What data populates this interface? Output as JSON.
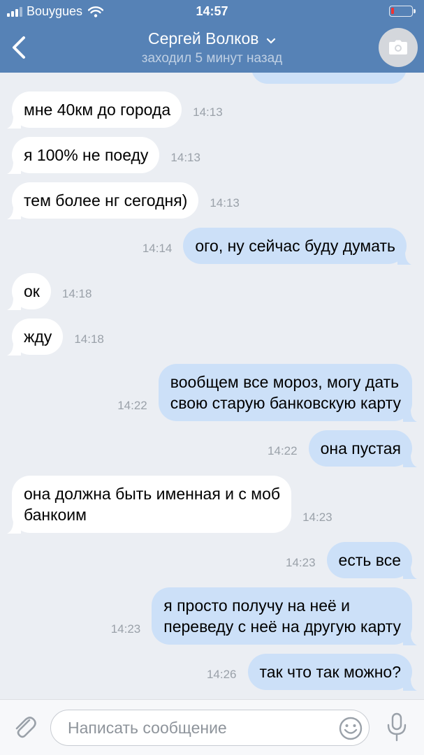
{
  "status_bar": {
    "carrier": "Bouygues",
    "time": "14:57",
    "battery_level": 0.15
  },
  "header": {
    "back_icon": "chevron-left-icon",
    "contact_name": "Сергей Волков",
    "status": "заходил 5 минут назад",
    "camera_icon": "camera-icon"
  },
  "messages": [
    {
      "dir": "in",
      "text": "мне 40км до города",
      "time": "14:13"
    },
    {
      "dir": "in",
      "text": "я 100% не поеду",
      "time": "14:13"
    },
    {
      "dir": "in",
      "text": "тем более нг сегодня)",
      "time": "14:13"
    },
    {
      "dir": "out",
      "text": "ого, ну сейчас буду думать",
      "time": "14:14"
    },
    {
      "dir": "in",
      "text": "ок",
      "time": "14:18"
    },
    {
      "dir": "in",
      "text": "жду",
      "time": "14:18"
    },
    {
      "dir": "out",
      "lines": [
        "вообщем все мороз, могу дать",
        "свою старую банковскую карту"
      ],
      "time": "14:22"
    },
    {
      "dir": "out",
      "text": "она пустая",
      "time": "14:22"
    },
    {
      "dir": "in",
      "lines": [
        "она должна быть именная и с моб",
        "банкоим"
      ],
      "time": "14:23"
    },
    {
      "dir": "out",
      "text": "есть все",
      "time": "14:23"
    },
    {
      "dir": "out",
      "lines": [
        "я просто получу на неё и",
        "переведу с неё на другую карту"
      ],
      "time": "14:23"
    },
    {
      "dir": "out",
      "text": "так что так можно?",
      "time": "14:26"
    }
  ],
  "composer": {
    "attach_icon": "paperclip-icon",
    "placeholder": "Написать сообщение",
    "emoji_icon": "emoji-icon",
    "mic_icon": "microphone-icon"
  }
}
